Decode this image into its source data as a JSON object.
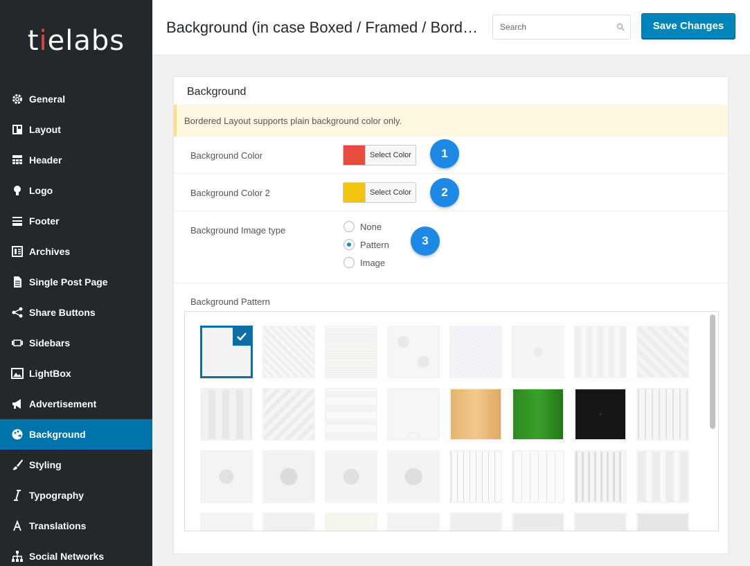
{
  "brand": {
    "logo_text_left": "t",
    "logo_text_dot": "i",
    "logo_text_right": "elabs"
  },
  "sidebar": {
    "items": [
      {
        "label": "General",
        "icon": "gear-icon"
      },
      {
        "label": "Layout",
        "icon": "layout-icon"
      },
      {
        "label": "Header",
        "icon": "header-icon"
      },
      {
        "label": "Logo",
        "icon": "lightbulb-icon"
      },
      {
        "label": "Footer",
        "icon": "footer-icon"
      },
      {
        "label": "Archives",
        "icon": "archive-icon"
      },
      {
        "label": "Single Post Page",
        "icon": "document-icon"
      },
      {
        "label": "Share Buttons",
        "icon": "share-icon"
      },
      {
        "label": "Sidebars",
        "icon": "sidebars-icon"
      },
      {
        "label": "LightBox",
        "icon": "image-icon"
      },
      {
        "label": "Advertisement",
        "icon": "megaphone-icon"
      },
      {
        "label": "Background",
        "icon": "paint-icon",
        "active": true
      },
      {
        "label": "Styling",
        "icon": "brush-icon"
      },
      {
        "label": "Typography",
        "icon": "italic-icon"
      },
      {
        "label": "Translations",
        "icon": "translate-icon"
      },
      {
        "label": "Social Networks",
        "icon": "network-icon"
      }
    ]
  },
  "header": {
    "title": "Background (in case Boxed / Framed / Bord…",
    "search_placeholder": "Search",
    "save_label": "Save Changes"
  },
  "panel": {
    "title": "Background",
    "notice": "Bordered Layout supports plain background color only.",
    "bg_color": {
      "label": "Background Color",
      "button": "Select Color",
      "color": "#e74c3c",
      "badge": "1"
    },
    "bg_color2": {
      "label": "Background Color 2",
      "button": "Select Color",
      "color": "#f1c40f",
      "badge": "2"
    },
    "image_type": {
      "label": "Background Image type",
      "badge": "3",
      "options": [
        "None",
        "Pattern",
        "Image"
      ],
      "selected": "Pattern"
    },
    "pattern_label": "Background Pattern",
    "selected_pattern": 0
  },
  "colors": {
    "accent": "#0073aa",
    "sidebar": "#23282d",
    "badge": "#1e88e5"
  }
}
